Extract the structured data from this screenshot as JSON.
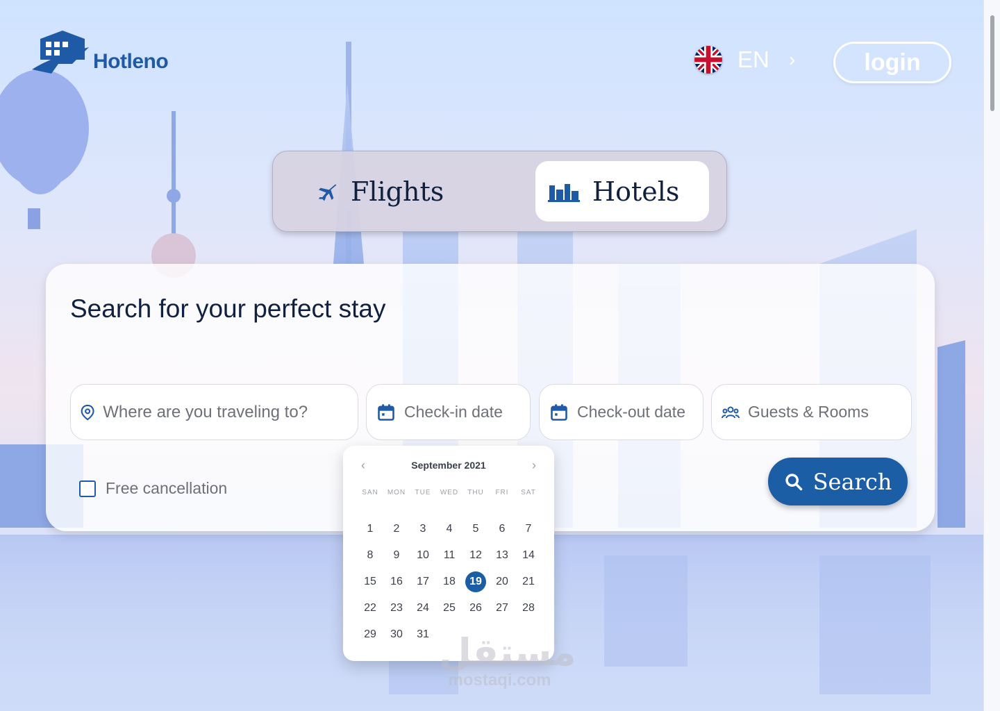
{
  "header": {
    "logo_text": "Hotleno",
    "language": "EN",
    "login_label": "login"
  },
  "tabs": [
    {
      "label": "Flights",
      "icon": "plane-icon",
      "active": false
    },
    {
      "label": "Hotels",
      "icon": "hotel-building-icon",
      "active": true
    }
  ],
  "search": {
    "title": "Search for your perfect stay",
    "destination_placeholder": "Where are you traveling to?",
    "checkin_label": "Check-in date",
    "checkout_label": "Check-out date",
    "guests_label": "Guests & Rooms",
    "free_cancellation_label": "Free cancellation",
    "free_cancellation_checked": false,
    "search_label": "Search"
  },
  "calendar": {
    "month": "September 2021",
    "weekdays": [
      "SAN",
      "MON",
      "TUE",
      "WED",
      "THU",
      "FRI",
      "SAT"
    ],
    "days": [
      "1",
      "2",
      "3",
      "4",
      "5",
      "6",
      "7",
      "8",
      "9",
      "10",
      "11",
      "12",
      "13",
      "14",
      "15",
      "16",
      "17",
      "18",
      "19",
      "20",
      "21",
      "22",
      "23",
      "24",
      "25",
      "26",
      "27",
      "28",
      "29",
      "30",
      "31"
    ],
    "selected_day": "19"
  },
  "watermark": {
    "arabic": "مستقل",
    "latin": "mostaqi.com"
  },
  "colors": {
    "brand": "#1f5aa6",
    "primary_button": "#1b5ea6",
    "heading_text": "#10213f",
    "muted_text": "#6d7077"
  }
}
